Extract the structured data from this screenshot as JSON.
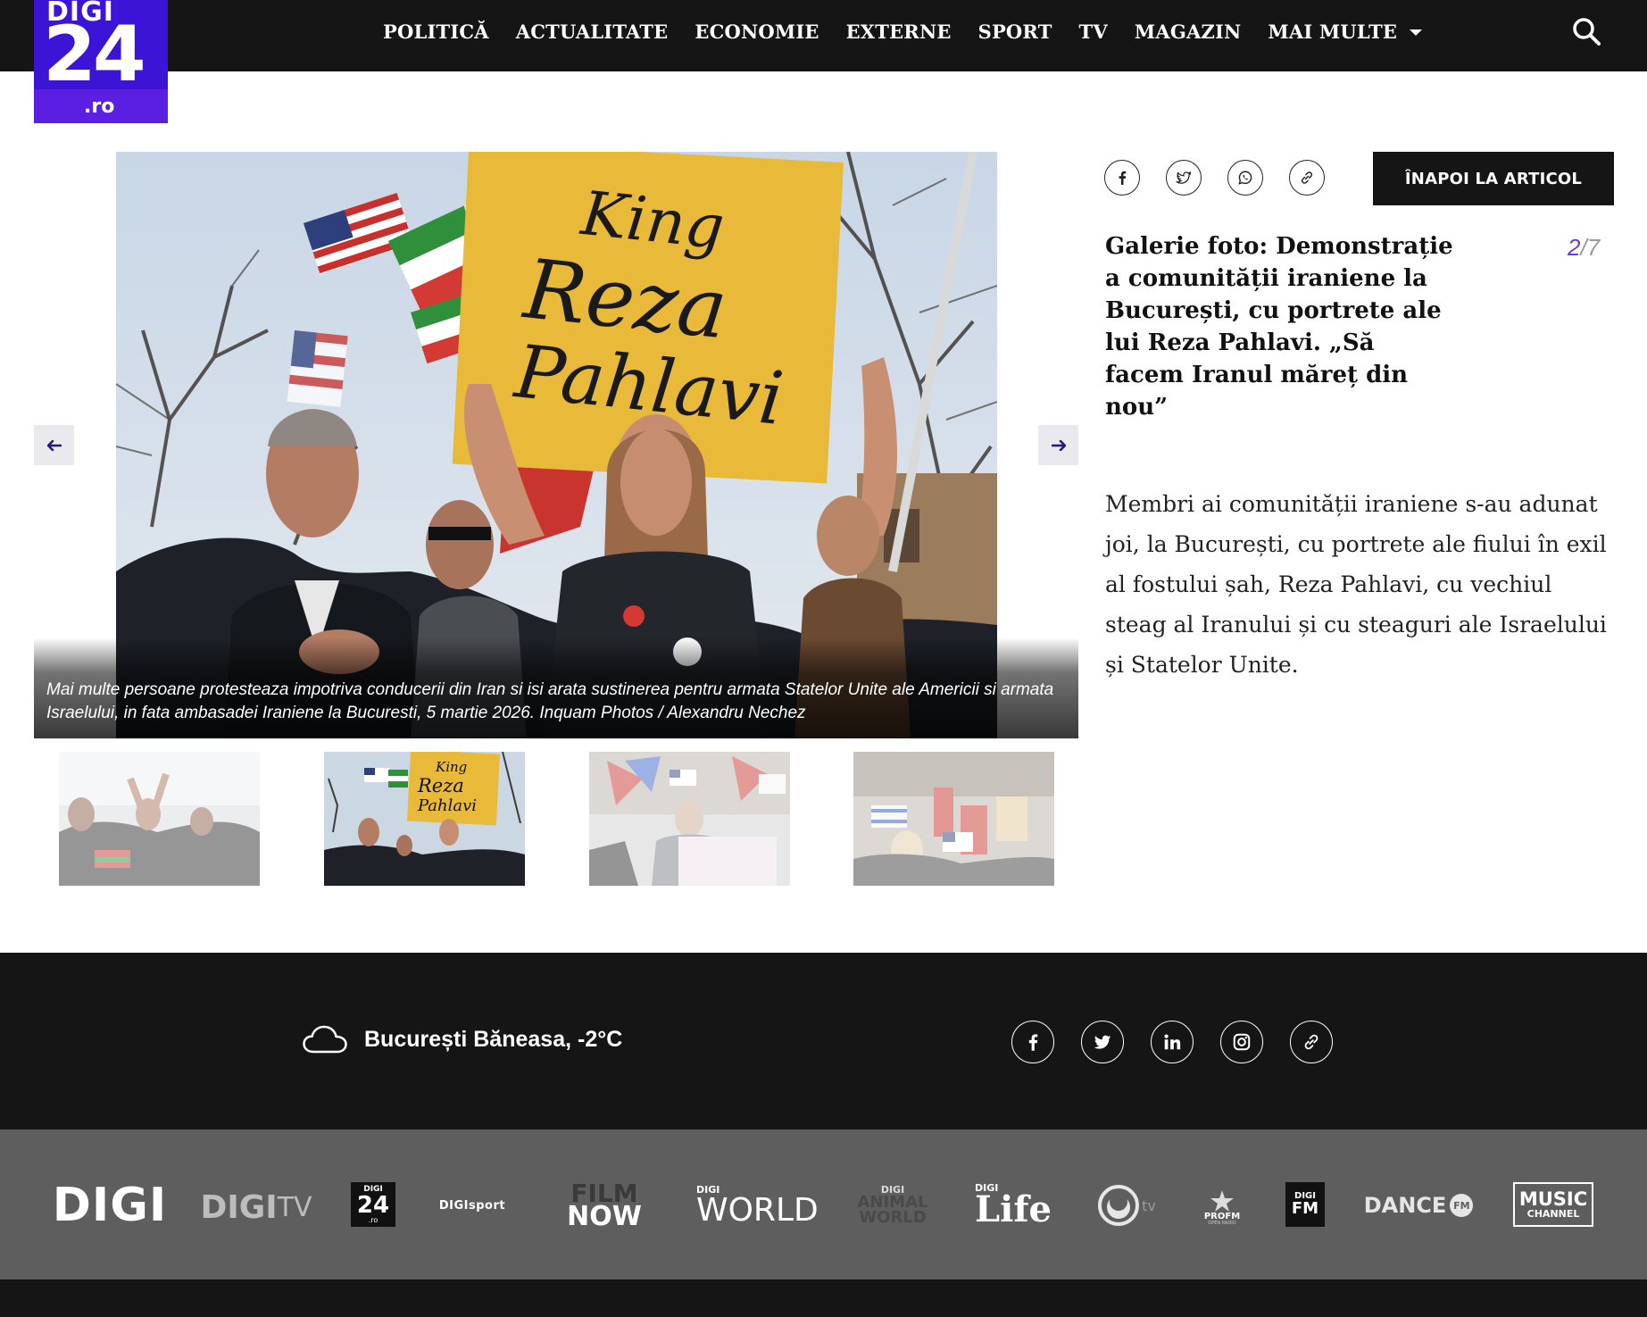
{
  "header": {
    "logo": {
      "top": "DIGI",
      "number": "24",
      "domain": ".ro"
    },
    "nav": [
      "POLITICĂ",
      "ACTUALITATE",
      "ECONOMIE",
      "EXTERNE",
      "SPORT",
      "TV",
      "MAGAZIN"
    ],
    "more_label": "MAI MULTE",
    "icons": {
      "search": "search-icon",
      "more": "chevron-down-icon"
    }
  },
  "gallery": {
    "caption": "Mai multe persoane protesteaza impotriva conducerii din Iran si isi arata sustinerea pentru armata Statelor Unite ale Americii si armata Israelului, in fata ambasadei Iraniene la Bucuresti, 5 martie 2026. Inquam Photos / Alexandru Nechez",
    "sign_text": [
      "King",
      "Reza",
      "Pahlavi"
    ],
    "current": "2",
    "total": "7",
    "separator": "/",
    "active_thumb_index": 1,
    "thumb_count": 4,
    "arrows": {
      "prev": "arrow-left-icon",
      "next": "arrow-right-icon"
    }
  },
  "article": {
    "back_label": "ÎNAPOI LA ARTICOL",
    "title": "Galerie foto: Demonstrație a comunității iraniene la București, cu portrete ale lui Reza Pahlavi. „Să facem Iranul măreț din nou”",
    "description": "Membri ai comunității iraniene s-au adunat joi, la București, cu portrete ale fiului în exil al fostului șah, Reza Pahlavi, cu vechiul steag al Iranului și cu steaguri ale Israelului și Statelor Unite.",
    "share_icons": [
      "facebook-icon",
      "twitter-icon",
      "whatsapp-icon",
      "link-icon"
    ]
  },
  "footer": {
    "weather": "București Băneasa, -2°C",
    "weather_icon": "cloud-icon",
    "social_icons": [
      "facebook-icon",
      "twitter-icon",
      "linkedin-icon",
      "instagram-icon",
      "link-icon"
    ],
    "brands": {
      "digi": "DIGI",
      "digitv_a": "DIGI",
      "digitv_b": "TV",
      "digi24_a": "DIGI",
      "digi24_b": "24",
      "digi24_c": ".ro",
      "digisport": "DIGIsport",
      "filmnow_a": "FILM",
      "filmnow_b": "NOW",
      "digiworld_a": "DIGI",
      "digiworld_b": "WORLD",
      "animal_a": "DIGI",
      "animal_b": "ANIMAL",
      "animal_c": "WORLD",
      "life_a": "DIGI",
      "life_b": "Life",
      "utv": "tv",
      "profm_a": "PROFM",
      "profm_b": "OPEN RADIO",
      "digifm_a": "DIGI",
      "digifm_b": "FM",
      "dance_a": "DANCE",
      "dance_b": "FM",
      "music_a": "MUSIC",
      "music_b": "CHANNEL"
    }
  },
  "colors": {
    "header_bg": "#151515",
    "logo_bg": "#3b14d6",
    "accent": "#6c3be8",
    "footer_brands_bg": "#5e5e5e",
    "sign_yellow": "#e9b93a"
  }
}
